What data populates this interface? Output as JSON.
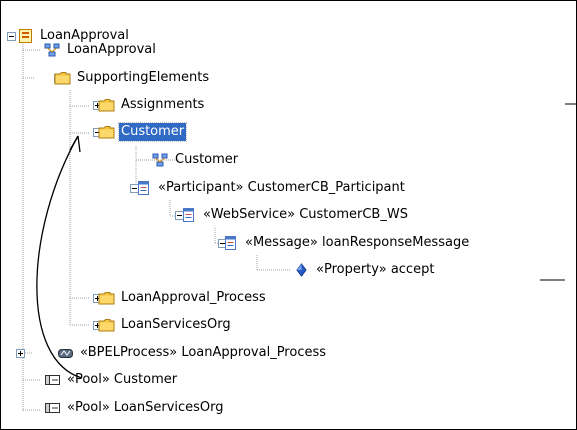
{
  "tree": {
    "nodes": [
      {
        "label": "LoanApproval",
        "icon": "model-icon",
        "toggle": "minus"
      },
      {
        "label": "LoanApproval",
        "icon": "diagram-icon",
        "toggle": ""
      },
      {
        "label": "SupportingElements",
        "icon": "folder-icon",
        "toggle": "minus"
      },
      {
        "label": "Assignments",
        "icon": "folder-icon",
        "toggle": "plus"
      },
      {
        "label": "Customer",
        "icon": "folder-icon",
        "toggle": "minus",
        "selected": true
      },
      {
        "label": "Customer",
        "icon": "diagram-icon",
        "toggle": ""
      },
      {
        "label": "«Participant» CustomerCB_Participant",
        "icon": "class-icon",
        "toggle": "minus"
      },
      {
        "label": "«WebService» CustomerCB_WS",
        "icon": "class-icon",
        "toggle": "minus"
      },
      {
        "label": "«Message» loanResponseMessage",
        "icon": "class-icon",
        "toggle": "minus"
      },
      {
        "label": "«Property» accept",
        "icon": "property-icon",
        "toggle": ""
      },
      {
        "label": "LoanApproval_Process",
        "icon": "folder-icon",
        "toggle": "plus"
      },
      {
        "label": "LoanServicesOrg",
        "icon": "folder-icon",
        "toggle": "plus"
      },
      {
        "label": "«BPELProcess» LoanApproval_Process",
        "icon": "bpel-icon",
        "toggle": "plus"
      },
      {
        "label": "«Pool» Customer",
        "icon": "pool-icon",
        "toggle": ""
      },
      {
        "label": "«Pool» LoanServicesOrg",
        "icon": "pool-icon",
        "toggle": ""
      }
    ]
  },
  "colors": {
    "selection": "#316ac5",
    "folder": "#f5c542",
    "class_icon": "#4a78c8",
    "tree_line": "#a0a0a0"
  }
}
